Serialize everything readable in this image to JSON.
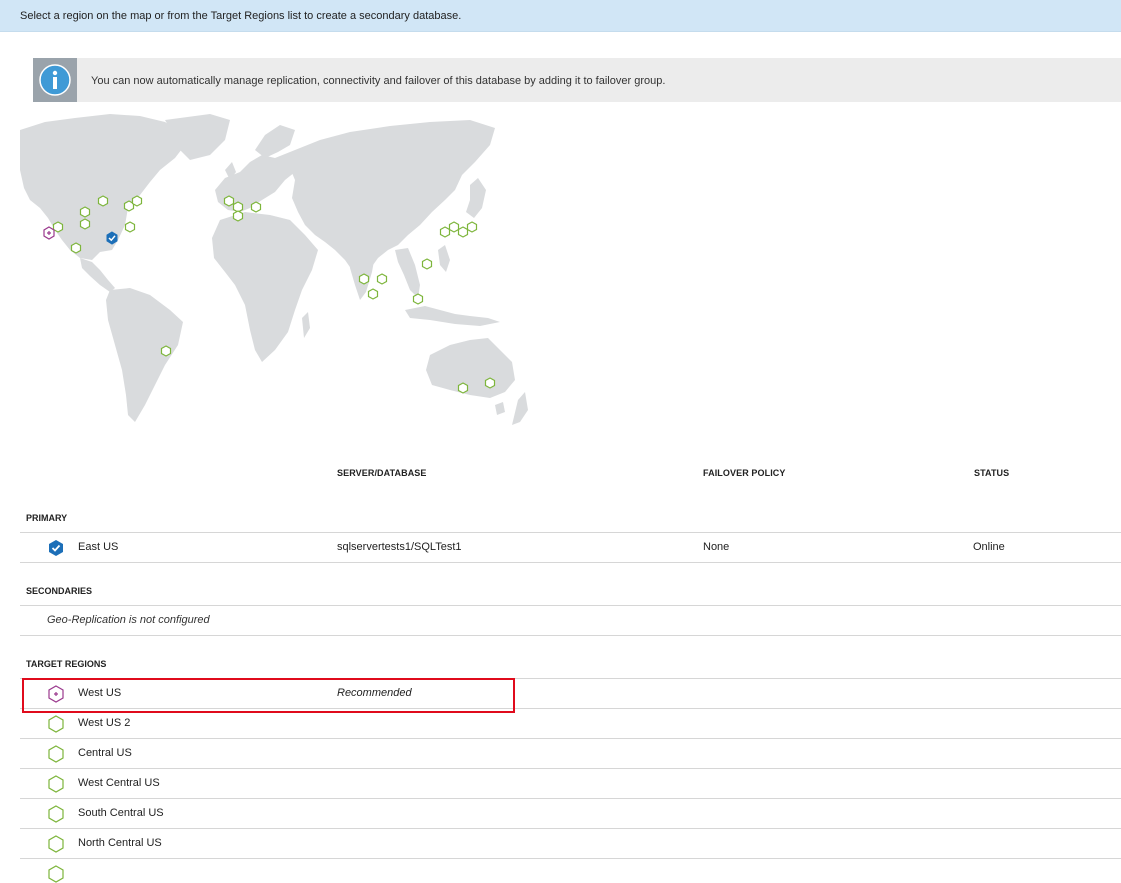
{
  "top_message": "Select a region on the map or from the Target Regions list to create a secondary database.",
  "info_message": "You can now automatically manage replication, connectivity and failover of this database by adding it to failover group.",
  "columns": {
    "server_database": "SERVER/DATABASE",
    "failover_policy": "FAILOVER POLICY",
    "status": "STATUS"
  },
  "primary": {
    "label": "PRIMARY",
    "region": "East US",
    "server_database": "sqlservertests1/SQLTest1",
    "failover_policy": "None",
    "status": "Online"
  },
  "secondaries": {
    "label": "SECONDARIES",
    "empty_message": "Geo-Replication is not configured"
  },
  "target_regions": {
    "label": "TARGET REGIONS",
    "recommended_text": "Recommended",
    "items": [
      {
        "name": "West US",
        "recommended": true
      },
      {
        "name": "West US 2"
      },
      {
        "name": "Central US"
      },
      {
        "name": "West Central US"
      },
      {
        "name": "South Central US"
      },
      {
        "name": "North Central US"
      }
    ]
  },
  "colors": {
    "primary_marker": "#1c6fb8",
    "available_marker": "#7db53b",
    "recommended_marker": "#9b3a8e",
    "highlight": "#e00b1c",
    "land": "#d9dbdd",
    "banner": "#d1e6f6"
  }
}
